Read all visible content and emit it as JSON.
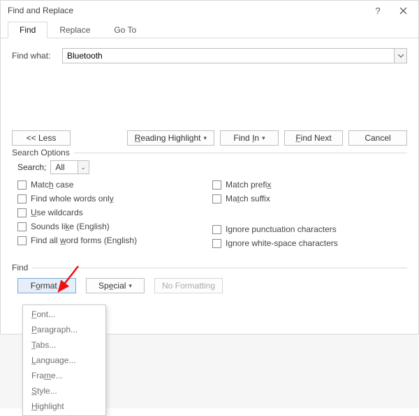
{
  "window": {
    "title": "Find and Replace"
  },
  "tabs": {
    "find": "Find",
    "replace": "Replace",
    "goto": "Go To"
  },
  "find": {
    "label": "Find what:",
    "value": "Bluetooth"
  },
  "buttons": {
    "less": "<<  Less",
    "reading_highlight": "Reading Highlight",
    "find_in": "Find In",
    "find_next": "Find Next",
    "cancel": "Cancel"
  },
  "search_options": {
    "legend": "Search Options",
    "search_label": "Search;",
    "search_value": "All",
    "left": {
      "match_case": "Match case",
      "whole_words": "Find whole words only",
      "wildcards": "Use wildcards",
      "sounds_like": "Sounds like (English)",
      "word_forms": "Find all word forms (English)"
    },
    "right": {
      "match_prefix": "Match prefix",
      "match_suffix": "Match suffix",
      "ignore_punct": "Ignore punctuation characters",
      "ignore_ws": "Ignore white-space characters"
    }
  },
  "find_section": {
    "legend": "Find",
    "format": "Format",
    "special": "Special",
    "no_formatting": "No Formatting"
  },
  "format_menu": {
    "font": "Font...",
    "paragraph": "Paragraph...",
    "tabs": "Tabs...",
    "language": "Language...",
    "frame": "Frame...",
    "style": "Style...",
    "highlight": "Highlight"
  }
}
